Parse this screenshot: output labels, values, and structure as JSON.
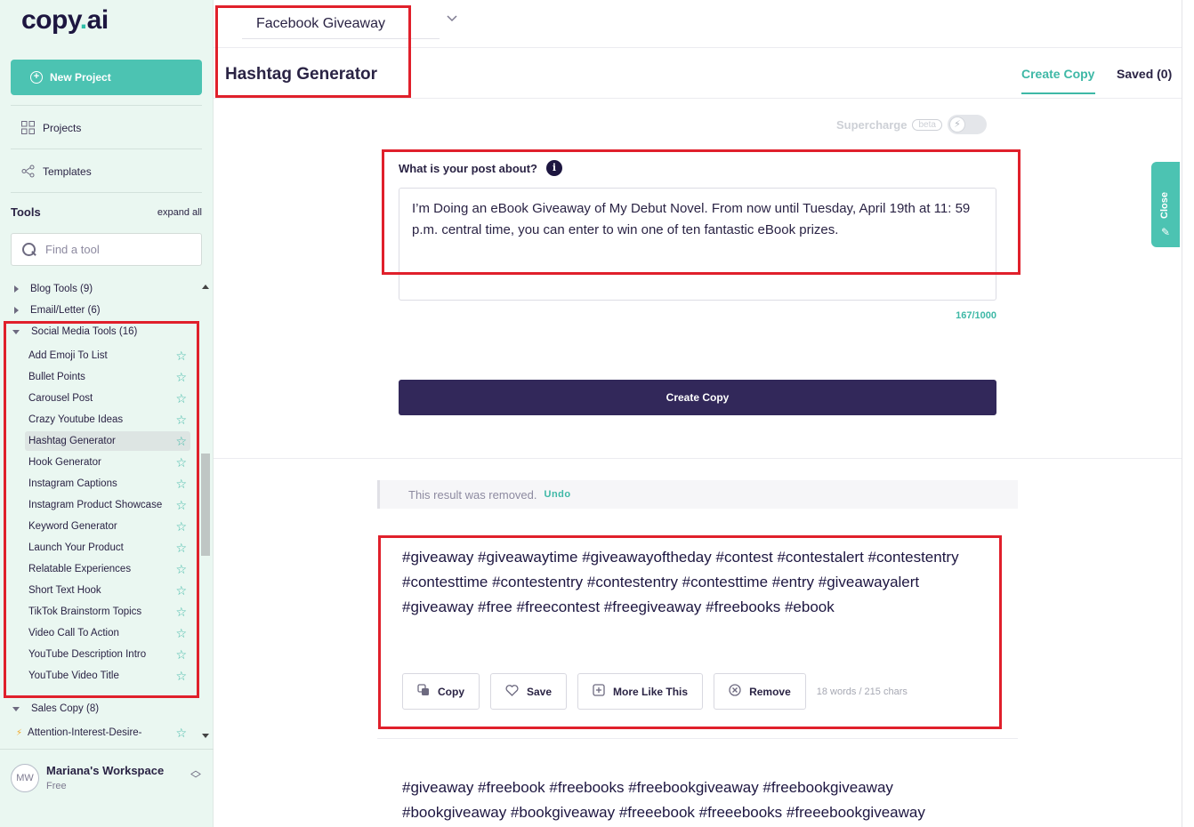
{
  "sidebar": {
    "logo": {
      "main": "copy",
      "dot": ".",
      "suffix": "ai"
    },
    "new_project": "New Project",
    "nav": [
      {
        "label": "Projects",
        "icon": "grid-icon"
      },
      {
        "label": "Templates",
        "icon": "share-icon"
      }
    ],
    "tools_title": "Tools",
    "expand_all": "expand all",
    "search_placeholder": "Find a tool",
    "categories": {
      "blog": "Blog Tools (9)",
      "email": "Email/Letter (6)",
      "social": "Social Media Tools (16)",
      "sales": "Sales Copy (8)",
      "sales_first": "Attention-Interest-Desire-"
    },
    "social_tools": [
      "Add Emoji To List",
      "Bullet Points",
      "Carousel Post",
      "Crazy Youtube Ideas",
      "Hashtag Generator",
      "Hook Generator",
      "Instagram Captions",
      "Instagram Product Showcase",
      "Keyword Generator",
      "Launch Your Product",
      "Relatable Experiences",
      "Short Text Hook",
      "TikTok Brainstorm Topics",
      "Video Call To Action",
      "YouTube Description Intro",
      "YouTube Video Title"
    ],
    "active_tool": "Hashtag Generator",
    "workspace": {
      "initials": "MW",
      "name": "Mariana's Workspace",
      "plan": "Free"
    }
  },
  "header": {
    "project": "Facebook Giveaway",
    "title": "Hashtag Generator",
    "tabs": [
      {
        "label": "Create Copy",
        "active": true
      },
      {
        "label": "Saved (0)",
        "active": false
      }
    ]
  },
  "form": {
    "supercharge": "Supercharge",
    "beta": "beta",
    "label": "What is your post about?",
    "value": "I’m Doing an eBook Giveaway of My Debut Novel. From now until Tuesday, April 19th at 11: 59 p.m. central time, you can enter to win one of ten fantastic eBook prizes.",
    "counter": "167/1000",
    "submit": "Create Copy"
  },
  "results": {
    "removed_text": "This result was removed.",
    "undo": "Undo",
    "first": "#giveaway #giveawaytime #giveawayoftheday #contest #contestalert #contestentry #contesttime #contestentry #contestentry #contesttime #entry #giveawayalert #giveaway #free #freecontest #freegiveaway #freebooks #ebook",
    "second": "#giveaway #freebook #freebooks #freebookgiveaway #freebookgiveaway #bookgiveaway #bookgiveaway #freeebook #freeebooks #freeebookgiveaway",
    "actions": {
      "copy": "Copy",
      "save": "Save",
      "more": "More Like This",
      "remove": "Remove"
    },
    "stats": "18 words / 215 chars"
  },
  "close_panel": "Close",
  "colors": {
    "accent": "#3eb8a6",
    "primary": "#32285a",
    "highlight": "#e0202b",
    "sidebar_bg": "#eaf7f1"
  }
}
